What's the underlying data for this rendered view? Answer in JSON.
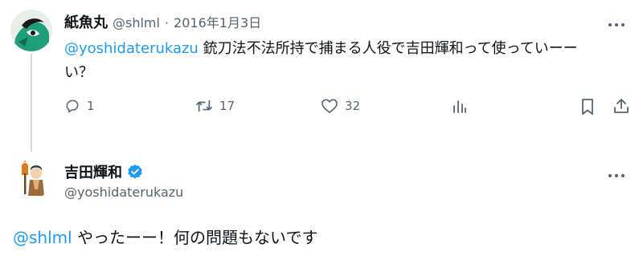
{
  "reply_tweet": {
    "display_name": "紙魚丸",
    "handle": "@shlml",
    "separator": "·",
    "date": "2016年1月3日",
    "mention": "@yoshidaterukazu",
    "text_line1": "銃刀法不法所持で捕まる人役で吉田輝和って使っていーー",
    "text_line2": "い？",
    "actions": {
      "reply_count": "1",
      "retweet_count": "17",
      "like_count": "32"
    },
    "more_icon": "more-horizontal-icon"
  },
  "main_tweet": {
    "display_name": "吉田輝和",
    "handle": "@yoshidaterukazu",
    "verified": true,
    "mention": "@shlml",
    "text": "やったーー！何の問題もないです",
    "more_icon": "more-horizontal-icon"
  },
  "colors": {
    "accent": "#1d9bf0",
    "secondary_text": "#536471",
    "thread_line": "#cfd9de"
  }
}
